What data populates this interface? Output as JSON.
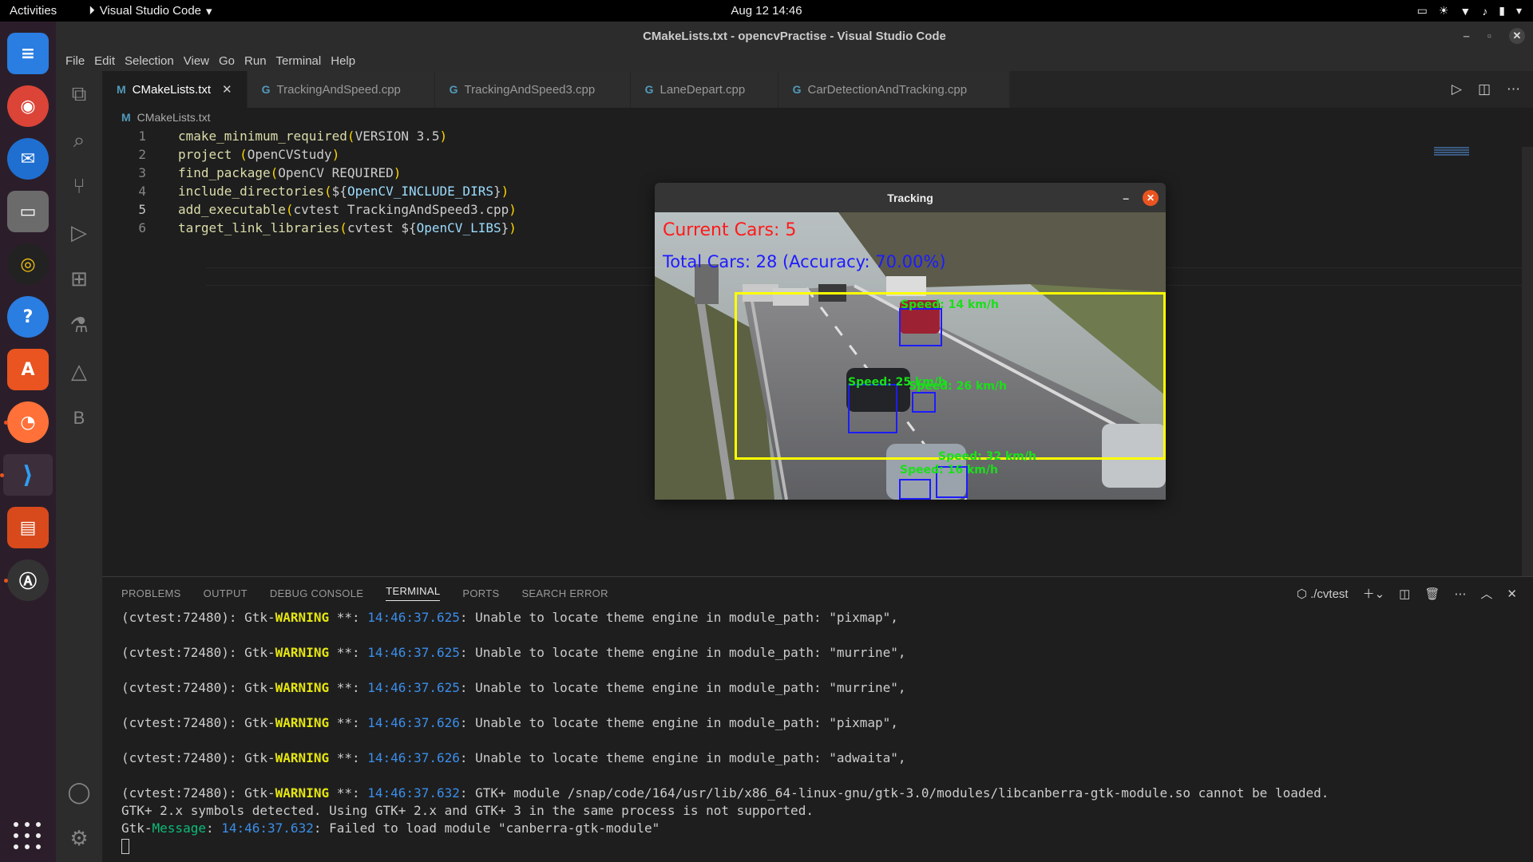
{
  "topbar": {
    "activities": "Activities",
    "app_name": "Visual Studio Code",
    "clock": "Aug 12  14:46"
  },
  "window": {
    "title": "CMakeLists.txt - opencvPractise - Visual Studio Code"
  },
  "menu": [
    "File",
    "Edit",
    "Selection",
    "View",
    "Go",
    "Run",
    "Terminal",
    "Help"
  ],
  "tabs": [
    {
      "label": "CMakeLists.txt",
      "icon": "M"
    },
    {
      "label": "TrackingAndSpeed.cpp",
      "icon": "G"
    },
    {
      "label": "TrackingAndSpeed3.cpp",
      "icon": "G"
    },
    {
      "label": "LaneDepart.cpp",
      "icon": "G"
    },
    {
      "label": "CarDetectionAndTracking.cpp",
      "icon": "G"
    }
  ],
  "breadcrumb": "CMakeLists.txt",
  "code": {
    "l1": {
      "n": "1",
      "fn": "cmake_minimum_required",
      "args": "VERSION 3.5"
    },
    "l2": {
      "n": "2",
      "fn": "project",
      "args": "OpenCVStudy"
    },
    "l3": {
      "n": "3",
      "fn": "find_package",
      "args": "OpenCV REQUIRED"
    },
    "l4": {
      "n": "4",
      "fn": "include_directories",
      "var": "OpenCV_INCLUDE_DIRS"
    },
    "l5": {
      "n": "5",
      "fn": "add_executable",
      "args": "cvtest TrackingAndSpeed3.cpp"
    },
    "l6": {
      "n": "6",
      "fn": "target_link_libraries",
      "args": "cvtest ",
      "var": "OpenCV_LIBS"
    }
  },
  "panel": {
    "tabs": [
      "PROBLEMS",
      "OUTPUT",
      "DEBUG CONSOLE",
      "TERMINAL",
      "PORTS",
      "SEARCH ERROR"
    ],
    "active_tab": "TERMINAL",
    "terminal_name": "./cvtest"
  },
  "terminal": {
    "prefix": "(cvtest:72480): Gtk-",
    "warning": "WARNING",
    "stars": " **: ",
    "lines": [
      {
        "ts": "14:46:37.625",
        "msg": ": Unable to locate theme engine in module_path: \"pixmap\","
      },
      {
        "ts": "14:46:37.625",
        "msg": ": Unable to locate theme engine in module_path: \"murrine\","
      },
      {
        "ts": "14:46:37.625",
        "msg": ": Unable to locate theme engine in module_path: \"murrine\","
      },
      {
        "ts": "14:46:37.626",
        "msg": ": Unable to locate theme engine in module_path: \"pixmap\","
      },
      {
        "ts": "14:46:37.626",
        "msg": ": Unable to locate theme engine in module_path: \"adwaita\","
      },
      {
        "ts": "14:46:37.632",
        "msg": ": GTK+ module /snap/code/164/usr/lib/x86_64-linux-gnu/gtk-3.0/modules/libcanberra-gtk-module.so cannot be loaded."
      }
    ],
    "extra1": "GTK+ 2.x symbols detected. Using GTK+ 2.x and GTK+ 3 in the same process is not supported.",
    "extra2_prefix": "Gtk-",
    "extra2_kw": "Message",
    "extra2_ts": "14:46:37.632",
    "extra2_msg": ": Failed to load module \"canberra-gtk-module\""
  },
  "tracking": {
    "title": "Tracking",
    "current_cars": "Current Cars: 5",
    "total_cars": "Total Cars: 28 (Accuracy: 70.00%)",
    "speeds": [
      "Speed: 14 km/h",
      "Speed: 25 km/h",
      "Speed: 26 km/h",
      "Speed: 32 km/h",
      "Speed: 16 km/h"
    ]
  }
}
